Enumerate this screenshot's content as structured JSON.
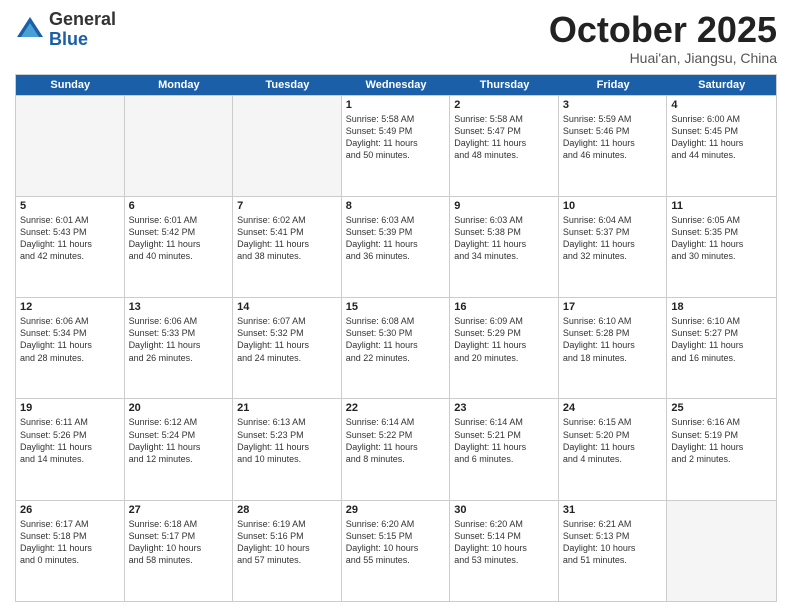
{
  "header": {
    "logo_general": "General",
    "logo_blue": "Blue",
    "month": "October 2025",
    "location": "Huai'an, Jiangsu, China"
  },
  "days_of_week": [
    "Sunday",
    "Monday",
    "Tuesday",
    "Wednesday",
    "Thursday",
    "Friday",
    "Saturday"
  ],
  "weeks": [
    [
      {
        "day": "",
        "empty": true,
        "lines": []
      },
      {
        "day": "",
        "empty": true,
        "lines": []
      },
      {
        "day": "",
        "empty": true,
        "lines": []
      },
      {
        "day": "1",
        "lines": [
          "Sunrise: 5:58 AM",
          "Sunset: 5:49 PM",
          "Daylight: 11 hours",
          "and 50 minutes."
        ]
      },
      {
        "day": "2",
        "lines": [
          "Sunrise: 5:58 AM",
          "Sunset: 5:47 PM",
          "Daylight: 11 hours",
          "and 48 minutes."
        ]
      },
      {
        "day": "3",
        "lines": [
          "Sunrise: 5:59 AM",
          "Sunset: 5:46 PM",
          "Daylight: 11 hours",
          "and 46 minutes."
        ]
      },
      {
        "day": "4",
        "lines": [
          "Sunrise: 6:00 AM",
          "Sunset: 5:45 PM",
          "Daylight: 11 hours",
          "and 44 minutes."
        ]
      }
    ],
    [
      {
        "day": "5",
        "lines": [
          "Sunrise: 6:01 AM",
          "Sunset: 5:43 PM",
          "Daylight: 11 hours",
          "and 42 minutes."
        ]
      },
      {
        "day": "6",
        "lines": [
          "Sunrise: 6:01 AM",
          "Sunset: 5:42 PM",
          "Daylight: 11 hours",
          "and 40 minutes."
        ]
      },
      {
        "day": "7",
        "lines": [
          "Sunrise: 6:02 AM",
          "Sunset: 5:41 PM",
          "Daylight: 11 hours",
          "and 38 minutes."
        ]
      },
      {
        "day": "8",
        "lines": [
          "Sunrise: 6:03 AM",
          "Sunset: 5:39 PM",
          "Daylight: 11 hours",
          "and 36 minutes."
        ]
      },
      {
        "day": "9",
        "lines": [
          "Sunrise: 6:03 AM",
          "Sunset: 5:38 PM",
          "Daylight: 11 hours",
          "and 34 minutes."
        ]
      },
      {
        "day": "10",
        "lines": [
          "Sunrise: 6:04 AM",
          "Sunset: 5:37 PM",
          "Daylight: 11 hours",
          "and 32 minutes."
        ]
      },
      {
        "day": "11",
        "lines": [
          "Sunrise: 6:05 AM",
          "Sunset: 5:35 PM",
          "Daylight: 11 hours",
          "and 30 minutes."
        ]
      }
    ],
    [
      {
        "day": "12",
        "lines": [
          "Sunrise: 6:06 AM",
          "Sunset: 5:34 PM",
          "Daylight: 11 hours",
          "and 28 minutes."
        ]
      },
      {
        "day": "13",
        "lines": [
          "Sunrise: 6:06 AM",
          "Sunset: 5:33 PM",
          "Daylight: 11 hours",
          "and 26 minutes."
        ]
      },
      {
        "day": "14",
        "lines": [
          "Sunrise: 6:07 AM",
          "Sunset: 5:32 PM",
          "Daylight: 11 hours",
          "and 24 minutes."
        ]
      },
      {
        "day": "15",
        "lines": [
          "Sunrise: 6:08 AM",
          "Sunset: 5:30 PM",
          "Daylight: 11 hours",
          "and 22 minutes."
        ]
      },
      {
        "day": "16",
        "lines": [
          "Sunrise: 6:09 AM",
          "Sunset: 5:29 PM",
          "Daylight: 11 hours",
          "and 20 minutes."
        ]
      },
      {
        "day": "17",
        "lines": [
          "Sunrise: 6:10 AM",
          "Sunset: 5:28 PM",
          "Daylight: 11 hours",
          "and 18 minutes."
        ]
      },
      {
        "day": "18",
        "lines": [
          "Sunrise: 6:10 AM",
          "Sunset: 5:27 PM",
          "Daylight: 11 hours",
          "and 16 minutes."
        ]
      }
    ],
    [
      {
        "day": "19",
        "lines": [
          "Sunrise: 6:11 AM",
          "Sunset: 5:26 PM",
          "Daylight: 11 hours",
          "and 14 minutes."
        ]
      },
      {
        "day": "20",
        "lines": [
          "Sunrise: 6:12 AM",
          "Sunset: 5:24 PM",
          "Daylight: 11 hours",
          "and 12 minutes."
        ]
      },
      {
        "day": "21",
        "lines": [
          "Sunrise: 6:13 AM",
          "Sunset: 5:23 PM",
          "Daylight: 11 hours",
          "and 10 minutes."
        ]
      },
      {
        "day": "22",
        "lines": [
          "Sunrise: 6:14 AM",
          "Sunset: 5:22 PM",
          "Daylight: 11 hours",
          "and 8 minutes."
        ]
      },
      {
        "day": "23",
        "lines": [
          "Sunrise: 6:14 AM",
          "Sunset: 5:21 PM",
          "Daylight: 11 hours",
          "and 6 minutes."
        ]
      },
      {
        "day": "24",
        "lines": [
          "Sunrise: 6:15 AM",
          "Sunset: 5:20 PM",
          "Daylight: 11 hours",
          "and 4 minutes."
        ]
      },
      {
        "day": "25",
        "lines": [
          "Sunrise: 6:16 AM",
          "Sunset: 5:19 PM",
          "Daylight: 11 hours",
          "and 2 minutes."
        ]
      }
    ],
    [
      {
        "day": "26",
        "lines": [
          "Sunrise: 6:17 AM",
          "Sunset: 5:18 PM",
          "Daylight: 11 hours",
          "and 0 minutes."
        ]
      },
      {
        "day": "27",
        "lines": [
          "Sunrise: 6:18 AM",
          "Sunset: 5:17 PM",
          "Daylight: 10 hours",
          "and 58 minutes."
        ]
      },
      {
        "day": "28",
        "lines": [
          "Sunrise: 6:19 AM",
          "Sunset: 5:16 PM",
          "Daylight: 10 hours",
          "and 57 minutes."
        ]
      },
      {
        "day": "29",
        "lines": [
          "Sunrise: 6:20 AM",
          "Sunset: 5:15 PM",
          "Daylight: 10 hours",
          "and 55 minutes."
        ]
      },
      {
        "day": "30",
        "lines": [
          "Sunrise: 6:20 AM",
          "Sunset: 5:14 PM",
          "Daylight: 10 hours",
          "and 53 minutes."
        ]
      },
      {
        "day": "31",
        "lines": [
          "Sunrise: 6:21 AM",
          "Sunset: 5:13 PM",
          "Daylight: 10 hours",
          "and 51 minutes."
        ]
      },
      {
        "day": "",
        "empty": true,
        "lines": []
      }
    ]
  ]
}
